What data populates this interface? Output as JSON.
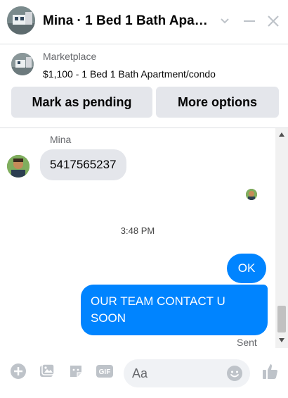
{
  "header": {
    "title": "Mina · 1 Bed 1 Bath Apart···"
  },
  "listing": {
    "label": "Marketplace",
    "title": "$1,100 - 1 Bed 1 Bath Apartment/condo",
    "pending_button": "Mark as pending",
    "options_button": "More options"
  },
  "conversation": {
    "sender_name": "Mina",
    "incoming_message": "5417565237",
    "timestamp": "3:48 PM",
    "outgoing_messages": [
      "OK",
      "OUR TEAM CONTACT U SOON"
    ],
    "status": "Sent"
  },
  "composer": {
    "placeholder": "Aa"
  },
  "colors": {
    "accent": "#0084ff",
    "icon": "#bec3c9"
  }
}
